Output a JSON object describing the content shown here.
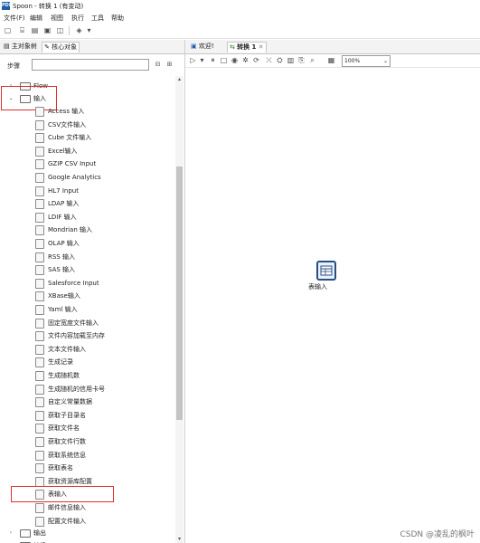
{
  "window": {
    "title": "Spoon - 转换 1 (有变动)",
    "logo": "PDI"
  },
  "menubar": [
    "文件(F)",
    "编辑",
    "视图",
    "执行",
    "工具",
    "帮助"
  ],
  "left_panel": {
    "tabs": [
      "主对象树",
      "核心对象"
    ],
    "steps_label": "步骤",
    "tree": {
      "flow": "Flow",
      "input_folder": "输入",
      "items": [
        "Access 输入",
        "CSV文件输入",
        "Cube 文件输入",
        "Excel输入",
        "GZIP CSV Input",
        "Google Analytics",
        "HL7 Input",
        "LDAP 输入",
        "LDIF 输入",
        "Mondrian 输入",
        "OLAP 输入",
        "RSS 输入",
        "SAS 输入",
        "Salesforce Input",
        "XBase输入",
        "Yaml 输入",
        "固定宽度文件输入",
        "文件内容加载至内存",
        "文本文件输入",
        "生成记录",
        "生成随机数",
        "生成随机的信用卡号",
        "自定义常量数据",
        "获取子目录名",
        "获取文件名",
        "获取文件行数",
        "获取系统信息",
        "获取表名",
        "获取资源库配置",
        "表输入",
        "邮件信息输入",
        "配置文件输入"
      ],
      "output_folder": "输出",
      "transform_folder": "转换"
    }
  },
  "right_panel": {
    "tabs": [
      "欢迎!",
      "转换 1"
    ],
    "zoom": "100%",
    "node_label": "表输入"
  },
  "watermark": "CSDN @凌乱的枫叶"
}
